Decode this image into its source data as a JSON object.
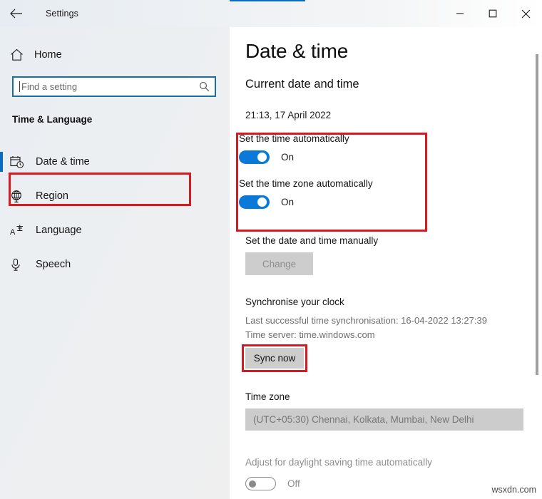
{
  "window": {
    "title": "Settings",
    "back_icon": "back-arrow-icon",
    "minimize_label": "Minimize",
    "maximize_label": "Maximize",
    "close_label": "Close",
    "accent_color": "#0b6cbf"
  },
  "sidebar": {
    "home": {
      "label": "Home",
      "icon": "home-icon"
    },
    "search": {
      "value": "",
      "placeholder": "Find a setting",
      "icon": "search-icon"
    },
    "section_heading": "Time & Language",
    "items": [
      {
        "label": "Date & time",
        "icon": "calendar-clock-icon",
        "selected": true
      },
      {
        "label": "Region",
        "icon": "globe-icon",
        "selected": false
      },
      {
        "label": "Language",
        "icon": "language-icon",
        "selected": false
      },
      {
        "label": "Speech",
        "icon": "microphone-icon",
        "selected": false
      }
    ]
  },
  "main": {
    "page_title": "Date & time",
    "subheading": "Current date and time",
    "current_datetime": "21:13, 17 April 2022",
    "auto_time": {
      "label": "Set the time automatically",
      "state": "On"
    },
    "auto_timezone": {
      "label": "Set the time zone automatically",
      "state": "On"
    },
    "manual": {
      "label": "Set the date and time manually",
      "button_label": "Change"
    },
    "sync": {
      "heading": "Synchronise your clock",
      "last_sync": "Last successful time synchronisation: 16-04-2022 13:27:39",
      "time_server": "Time server: time.windows.com",
      "button_label": "Sync now"
    },
    "timezone": {
      "label": "Time zone",
      "selected": "(UTC+05:30) Chennai, Kolkata, Mumbai, New Delhi"
    },
    "daylight": {
      "label": "Adjust for daylight saving time automatically",
      "state": "Off"
    }
  },
  "annotations": {
    "highlight_color": "#d61a21"
  },
  "watermark": "wsxdn.com"
}
